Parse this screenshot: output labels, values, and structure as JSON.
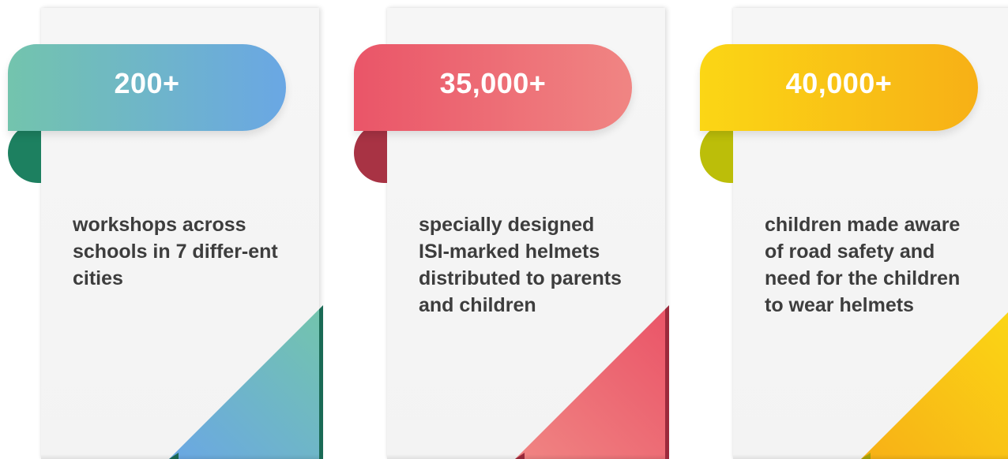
{
  "cards": [
    {
      "stat": "200+",
      "description": "workshops across schools in 7 differ-ent cities",
      "colors": {
        "start": "#73c4ad",
        "end": "#6aa7e4",
        "fold": "#1d8060",
        "corner_dark": "#1a6a55"
      }
    },
    {
      "stat": "35,000+",
      "description": "specially designed ISI-marked helmets distributed to parents and children",
      "colors": {
        "start": "#ea5568",
        "end": "#f08583",
        "fold": "#a83344",
        "corner_dark": "#9c2a3c"
      }
    },
    {
      "stat": "40,000+",
      "description": "children made aware of road safety and need for the children to wear helmets",
      "colors": {
        "start": "#fbd615",
        "end": "#f7b016",
        "fold": "#bcbe09",
        "corner_dark": "#a9a408"
      }
    }
  ]
}
